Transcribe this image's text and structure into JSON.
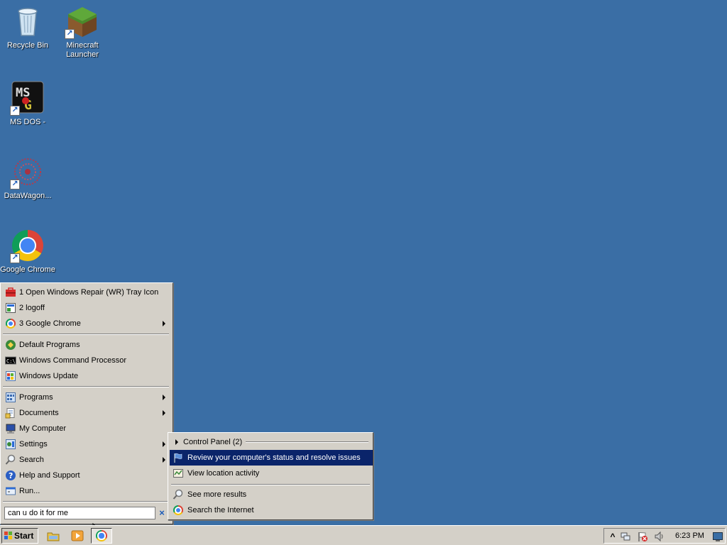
{
  "desktop": {
    "icons": [
      {
        "label": "Recycle Bin",
        "icon": "recycle-bin-icon"
      },
      {
        "label": "Minecraft Launcher",
        "icon": "minecraft-icon"
      },
      {
        "label": "MS DOS -",
        "icon": "msdos-icon"
      },
      {
        "label": "DataWagon...",
        "icon": "datawagon-icon"
      },
      {
        "label": "Google Chrome",
        "icon": "chrome-icon"
      }
    ]
  },
  "start_menu": {
    "recent": [
      {
        "label": "1 Open Windows Repair (WR) Tray Icon",
        "icon": "toolbox-icon"
      },
      {
        "label": "2 logoff",
        "icon": "logoff-icon"
      },
      {
        "label": "3 Google Chrome",
        "icon": "chrome-icon",
        "submenu": true
      }
    ],
    "pinned": [
      {
        "label": "Default Programs",
        "icon": "default-programs-icon"
      },
      {
        "label": "Windows Command Processor",
        "icon": "cmd-icon"
      },
      {
        "label": "Windows Update",
        "icon": "windows-update-icon"
      }
    ],
    "main": [
      {
        "label": "Programs",
        "icon": "programs-icon",
        "submenu": true
      },
      {
        "label": "Documents",
        "icon": "documents-icon",
        "submenu": true
      },
      {
        "label": "My Computer",
        "icon": "computer-icon"
      },
      {
        "label": "Settings",
        "icon": "settings-icon",
        "submenu": true
      },
      {
        "label": "Search",
        "icon": "search-icon",
        "submenu": true
      },
      {
        "label": "Help and Support",
        "icon": "help-icon"
      },
      {
        "label": "Run...",
        "icon": "run-icon"
      }
    ],
    "search_value": "can u do it for me",
    "clear_label": "×"
  },
  "search_results": {
    "group_label": "Control Panel (2)",
    "items": [
      {
        "label": "Review your computer's status and resolve issues",
        "icon": "flag-icon",
        "selected": true
      },
      {
        "label": "View location activity",
        "icon": "location-activity-icon"
      }
    ],
    "footer": [
      {
        "label": "See more results",
        "icon": "search-icon"
      },
      {
        "label": "Search the Internet",
        "icon": "chrome-icon"
      }
    ]
  },
  "taskbar": {
    "start_label": "Start",
    "clock": "6:23 PM",
    "show_hidden": "^"
  }
}
